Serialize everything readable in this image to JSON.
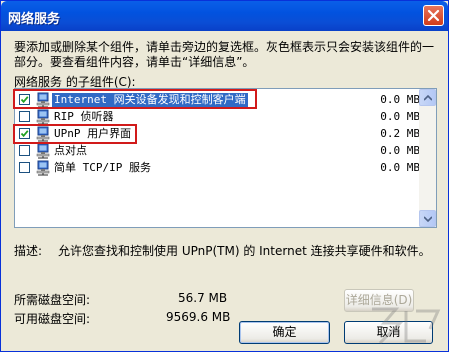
{
  "window": {
    "title": "网络服务"
  },
  "description": "要添加或删除某个组件，请单击旁边的复选框。灰色框表示只会安装该组件的一部分。要查看组件内容，请单击“详细信息”。",
  "components_label": "网络服务 的子组件(C):",
  "components": [
    {
      "name": "Internet 网关设备发现和控制客户端",
      "size": "0.0 MB",
      "checked": true,
      "selected": true
    },
    {
      "name": "RIP 侦听器",
      "size": "0.0 MB",
      "checked": false,
      "selected": false
    },
    {
      "name": "UPnP 用户界面",
      "size": "0.2 MB",
      "checked": true,
      "selected": false
    },
    {
      "name": "点对点",
      "size": "0.0 MB",
      "checked": false,
      "selected": false
    },
    {
      "name": "简单 TCP/IP 服务",
      "size": "0.0 MB",
      "checked": false,
      "selected": false
    }
  ],
  "component_description": {
    "label": "描述:",
    "text": "允许您查找和控制使用 UPnP(TM) 的 Internet 连接共享硬件和软件。"
  },
  "disk": {
    "required_label": "所需磁盘空间:",
    "required_value": "56.7 MB",
    "available_label": "可用磁盘空间:",
    "available_value": "9569.6 MB"
  },
  "buttons": {
    "details": "详细信息(D)",
    "ok": "确定",
    "cancel": "取消"
  },
  "colors": {
    "titlebar": "#0A5FE8",
    "selection": "#316AC5",
    "highlight_box": "#D11A1A",
    "dialog_bg": "#ECE9D8"
  },
  "icons": [
    "close-icon",
    "checkmark-icon",
    "network-component-icon",
    "scroll-up-icon",
    "scroll-down-icon"
  ]
}
